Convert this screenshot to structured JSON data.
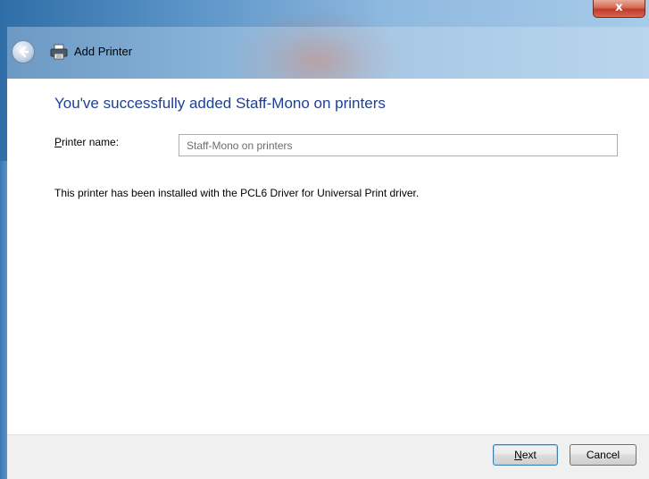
{
  "window": {
    "title": "Add Printer",
    "close_label": "x"
  },
  "icons": {
    "back": "back-arrow-icon",
    "printer": "printer-icon",
    "close": "close-icon"
  },
  "main": {
    "heading": "You've successfully added Staff-Mono on printers",
    "printer_name_label_access_key": "P",
    "printer_name_label_rest": "rinter name:",
    "printer_name_value": "Staff-Mono on printers",
    "info_text": "This printer has been installed with the PCL6 Driver for Universal Print driver."
  },
  "footer": {
    "next_access_key": "N",
    "next_rest": "ext",
    "cancel_label": "Cancel"
  },
  "colors": {
    "heading": "#1e3f93",
    "close_button": "#c0392b",
    "footer_bg": "#f0f0f0"
  }
}
